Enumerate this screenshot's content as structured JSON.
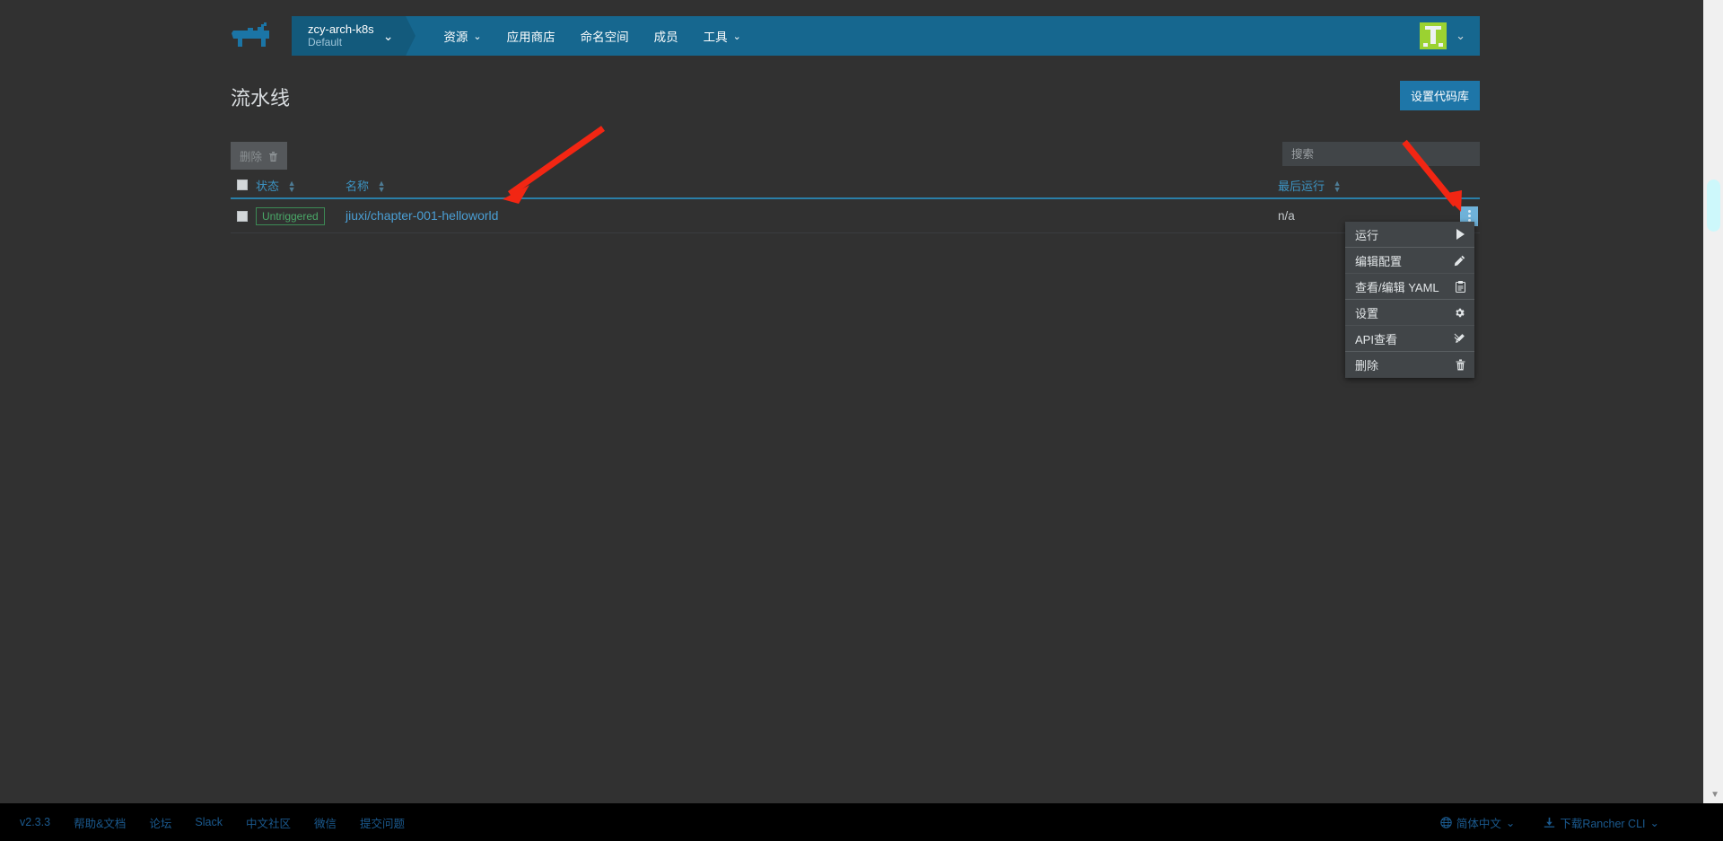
{
  "header": {
    "logo_icon": "rancher-cow-logo",
    "cluster": {
      "name": "zcy-arch-k8s",
      "project": "Default",
      "chevron": "⌄"
    },
    "nav": [
      {
        "label": "资源",
        "has_chevron": true,
        "name": "resources"
      },
      {
        "label": "应用商店",
        "has_chevron": false,
        "name": "apps"
      },
      {
        "label": "命名空间",
        "has_chevron": false,
        "name": "namespaces"
      },
      {
        "label": "成员",
        "has_chevron": false,
        "name": "members"
      },
      {
        "label": "工具",
        "has_chevron": true,
        "name": "tools"
      }
    ],
    "chevron_glyph": "⌄",
    "user": {
      "avatar_initial": "T",
      "chevron": "⌄"
    }
  },
  "page": {
    "title": "流水线",
    "primary_button": "设置代码库"
  },
  "toolbar": {
    "delete_label": "删除",
    "delete_icon": "trash-icon",
    "search_placeholder": "搜索",
    "search_value": ""
  },
  "table": {
    "columns": [
      {
        "label": "状态",
        "sortable": true,
        "name": "state"
      },
      {
        "label": "名称",
        "sortable": true,
        "name": "name"
      },
      {
        "label": "最后运行",
        "sortable": true,
        "name": "last-run"
      }
    ],
    "rows": [
      {
        "state": "Untriggered",
        "name": "jiuxi/chapter-001-helloworld",
        "last_run": "n/a"
      }
    ]
  },
  "context_menu": [
    {
      "label": "运行",
      "icon": "play-icon",
      "name": "run"
    },
    {
      "label": "编辑配置",
      "icon": "pencil-icon",
      "name": "edit-config"
    },
    {
      "label": "查看/编辑 YAML",
      "icon": "clipboard-icon",
      "name": "view-edit-yaml"
    },
    {
      "label": "设置",
      "icon": "gear-icon",
      "name": "settings"
    },
    {
      "label": "API查看",
      "icon": "api-icon",
      "name": "api-view"
    },
    {
      "label": "删除",
      "icon": "trash-icon",
      "name": "delete"
    }
  ],
  "footer": {
    "left_links": [
      {
        "label": "v2.3.3",
        "name": "version"
      },
      {
        "label": "帮助&文档",
        "name": "help-docs"
      },
      {
        "label": "论坛",
        "name": "forums"
      },
      {
        "label": "Slack",
        "name": "slack"
      },
      {
        "label": "中文社区",
        "name": "chinese-community"
      },
      {
        "label": "微信",
        "name": "wechat"
      },
      {
        "label": "提交问题",
        "name": "file-issue"
      }
    ],
    "language": {
      "label": "简体中文",
      "icon": "globe-icon",
      "chevron": "⌄"
    },
    "cli": {
      "label": "下载Rancher CLI",
      "icon": "download-icon",
      "chevron": "⌄"
    }
  },
  "colors": {
    "nav_blue": "#16678f",
    "accent": "#1e76a8",
    "badge_green": "#4aa868",
    "link_blue": "#4a9ed4",
    "annotation_red": "#f22613"
  }
}
